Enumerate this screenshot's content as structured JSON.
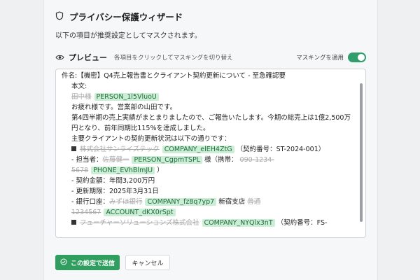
{
  "wizard": {
    "title": "プライバシー保護ウィザード",
    "subtitle": "以下の項目が推奨設定としてマスクされます。",
    "preview_label": "プレビュー",
    "preview_hint": "各項目をクリックしてマスキングを切り替え",
    "toggle_label": "マスキングを適用",
    "toggle_on": true
  },
  "email": {
    "subject": "件名:【機密】Q4売上報告書とクライアント契約更新について - 至急確認要",
    "body_label": "本文:",
    "name_original": "田中様",
    "name_token": "PERSON_1l5VluoU",
    "greeting": "お疲れ様です。営業部の山田です。",
    "para": "第4四半期の売上実績がまとまりましたので、ご報告いたします。今期の総売上は1億2,500万円となり、前年同期比115%を達成しました。",
    "contract_intro": "主要クライアントの契約更新状況は以下の通りです：",
    "company1_original": "株式会社サンライズテック",
    "company1_token": "COMPANY_elEH4ZtG",
    "company1_contract": "（契約番号：ST-2024-001）",
    "contact_prefix": "- 担当者：",
    "contact_original": "佐藤健一",
    "contact_token": "PERSON_CgpmTSPL",
    "contact_suffix": "様（携帯：",
    "phone_original_1": "090-1234-",
    "phone_original_2": "5678",
    "phone_token": "PHONE_EVhBlmJU",
    "phone_close": "）",
    "amount": "- 契約金額：年間3,200万円",
    "renewal": "- 更新期限：2025年3月31日",
    "bank_prefix": "- 銀行口座：",
    "bank_original": "みずほ銀行",
    "bank_token": "COMPANY_fz8q7yp7",
    "bank_branch": "新宿支店",
    "account_type": "普通",
    "account_original": "1234567",
    "account_token": "ACCOUNT_dKX0rSpt",
    "company2_original": "フューチャーソリューションズ株式会社",
    "company2_token": "COMPANY_NYQlx3nT",
    "company2_contract": "（契約番号：FS-"
  },
  "buttons": {
    "send": "この設定で送信",
    "cancel": "キャンセル"
  },
  "colors": {
    "accent": "#2f9e5f",
    "token_bg": "#cdeed6",
    "token_text": "#1c6b38"
  }
}
